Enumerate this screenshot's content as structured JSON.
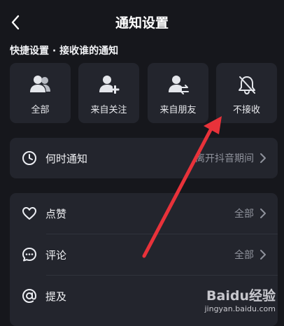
{
  "header": {
    "title": "通知设置",
    "back_icon": "chevron-left-icon"
  },
  "quick_settings": {
    "title": "快捷设置 · 接收谁的通知",
    "options": [
      {
        "label": "全部",
        "icon": "users-icon"
      },
      {
        "label": "来自关注",
        "icon": "user-plus-icon"
      },
      {
        "label": "来自朋友",
        "icon": "user-swap-icon"
      },
      {
        "label": "不接收",
        "icon": "bell-off-icon"
      }
    ]
  },
  "timing": {
    "label": "何时通知",
    "value": "离开抖音期间",
    "icon": "clock-icon"
  },
  "types": [
    {
      "label": "点赞",
      "value": "全部",
      "icon": "heart-icon"
    },
    {
      "label": "评论",
      "value": "全部",
      "icon": "comment-icon"
    },
    {
      "label": "提及",
      "value": "",
      "icon": "at-icon"
    }
  ],
  "annotation": {
    "color": "#e8323a"
  },
  "watermark": {
    "logo": "Baidu经验",
    "url": "jingyan.baidu.com"
  }
}
